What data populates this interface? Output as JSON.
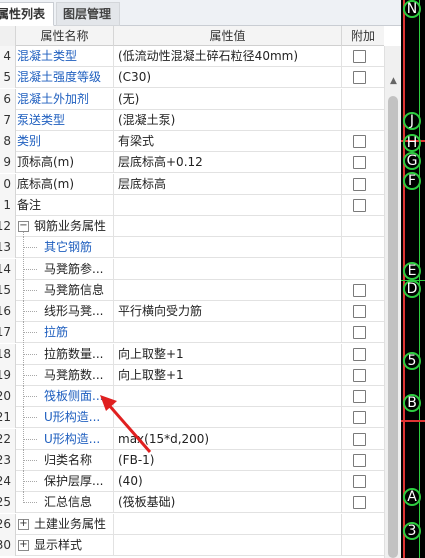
{
  "tabs": {
    "active": "属性列表",
    "inactive": "图层管理"
  },
  "columns": {
    "name": "属性名称",
    "value": "属性值",
    "add": "附加"
  },
  "rows": [
    {
      "num": "4",
      "name": "混凝土类型",
      "value": "(低流动性混凝土碎石粒径40mm)",
      "style": "blue",
      "indent": 0,
      "checkbox": true
    },
    {
      "num": "5",
      "name": "混凝土强度等级",
      "value": "(C30)",
      "style": "blue",
      "indent": 0,
      "checkbox": true
    },
    {
      "num": "6",
      "name": "混凝土外加剂",
      "value": "(无)",
      "style": "blue",
      "indent": 0,
      "checkbox": false
    },
    {
      "num": "7",
      "name": "泵送类型",
      "value": "(混凝土泵)",
      "style": "blue",
      "indent": 0,
      "checkbox": false
    },
    {
      "num": "8",
      "name": "类别",
      "value": "有梁式",
      "style": "blue",
      "indent": 0,
      "checkbox": true
    },
    {
      "num": "9",
      "name": "顶标高(m)",
      "value": "层底标高+0.12",
      "style": "dark",
      "indent": 0,
      "checkbox": true
    },
    {
      "num": "0",
      "name": "底标高(m)",
      "value": "层底标高",
      "style": "dark",
      "indent": 0,
      "checkbox": true
    },
    {
      "num": "1",
      "name": "备注",
      "value": "",
      "style": "dark",
      "indent": 0,
      "checkbox": true
    },
    {
      "num": "12",
      "name": "钢筋业务属性",
      "value": "",
      "style": "dark",
      "indent": 0,
      "checkbox": false,
      "expander": "−"
    },
    {
      "num": "13",
      "name": "其它钢筋",
      "value": "",
      "style": "blue",
      "indent": 1,
      "checkbox": false
    },
    {
      "num": "14",
      "name": "马凳筋参...",
      "value": "",
      "style": "dark",
      "indent": 1,
      "checkbox": false
    },
    {
      "num": "15",
      "name": "马凳筋信息",
      "value": "",
      "style": "dark",
      "indent": 1,
      "checkbox": true
    },
    {
      "num": "16",
      "name": "线形马凳...",
      "value": "平行横向受力筋",
      "style": "dark",
      "indent": 1,
      "checkbox": true
    },
    {
      "num": "17",
      "name": "拉筋",
      "value": "",
      "style": "blue",
      "indent": 1,
      "checkbox": true
    },
    {
      "num": "18",
      "name": "拉筋数量...",
      "value": "向上取整+1",
      "style": "dark",
      "indent": 1,
      "checkbox": true
    },
    {
      "num": "19",
      "name": "马凳筋数...",
      "value": "向上取整+1",
      "style": "dark",
      "indent": 1,
      "checkbox": true
    },
    {
      "num": "20",
      "name": "筏板侧面...",
      "value": "",
      "style": "blue",
      "indent": 1,
      "checkbox": true
    },
    {
      "num": "21",
      "name": "U形构造...",
      "value": "",
      "style": "blue",
      "indent": 1,
      "checkbox": true
    },
    {
      "num": "22",
      "name": "U形构造...",
      "value": "max(15*d,200)",
      "style": "blue",
      "indent": 1,
      "checkbox": true
    },
    {
      "num": "23",
      "name": "归类名称",
      "value": "(FB-1)",
      "style": "dark",
      "indent": 1,
      "checkbox": true
    },
    {
      "num": "24",
      "name": "保护层厚...",
      "value": "(40)",
      "style": "dark",
      "indent": 1,
      "checkbox": true
    },
    {
      "num": "25",
      "name": "汇总信息",
      "value": "(筏板基础)",
      "style": "dark",
      "indent": 1,
      "checkbox": true
    },
    {
      "num": "26",
      "name": "土建业务属性",
      "value": "",
      "style": "dark",
      "indent": 0,
      "checkbox": false,
      "expander": "+"
    },
    {
      "num": "30",
      "name": "显示样式",
      "value": "",
      "style": "dark",
      "indent": 0,
      "checkbox": false,
      "expander": "+"
    }
  ],
  "canvas_marks": [
    {
      "label": "N"
    },
    {
      "label": "J"
    },
    {
      "label": "H"
    },
    {
      "label": "G"
    },
    {
      "label": "F"
    },
    {
      "label": "E"
    },
    {
      "label": "D"
    },
    {
      "label": "5"
    },
    {
      "label": "B"
    },
    {
      "label": "A"
    },
    {
      "label": "3"
    }
  ],
  "colors": {
    "blue_link": "#1f5fbf",
    "arrow": "#e02020",
    "grid_green": "#2ecc40"
  },
  "icons": {
    "expand": "plus-box-icon",
    "collapse": "minus-box-icon",
    "scroll_up": "chevron-up-icon"
  }
}
